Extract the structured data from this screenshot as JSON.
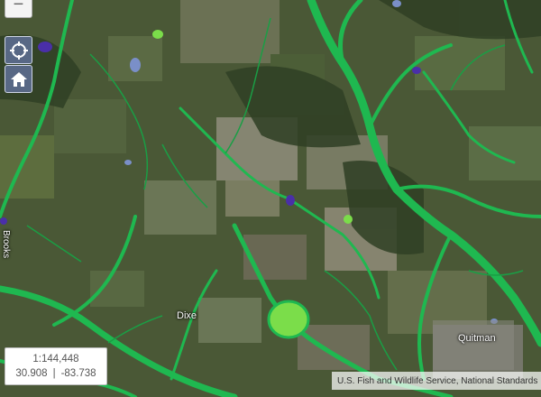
{
  "map": {
    "scale_label": "1:144,448",
    "latitude": "30.908",
    "coord_separator": "|",
    "longitude": "-83.738",
    "attribution": "U.S. Fish and Wildlife Service, National Standards",
    "places": {
      "dixe": "Dixe",
      "quitman": "Quitman",
      "brooks": "Brooks"
    }
  },
  "controls": {
    "zoom_out_label": "−",
    "locate_icon": "crosshair-icon",
    "home_icon": "home-icon"
  },
  "colors": {
    "wetland_green": "#1fb850",
    "lake_light_green": "#7bdd4a",
    "pond_purple": "#4a2fa8",
    "water_blue": "#7a8fc8"
  }
}
